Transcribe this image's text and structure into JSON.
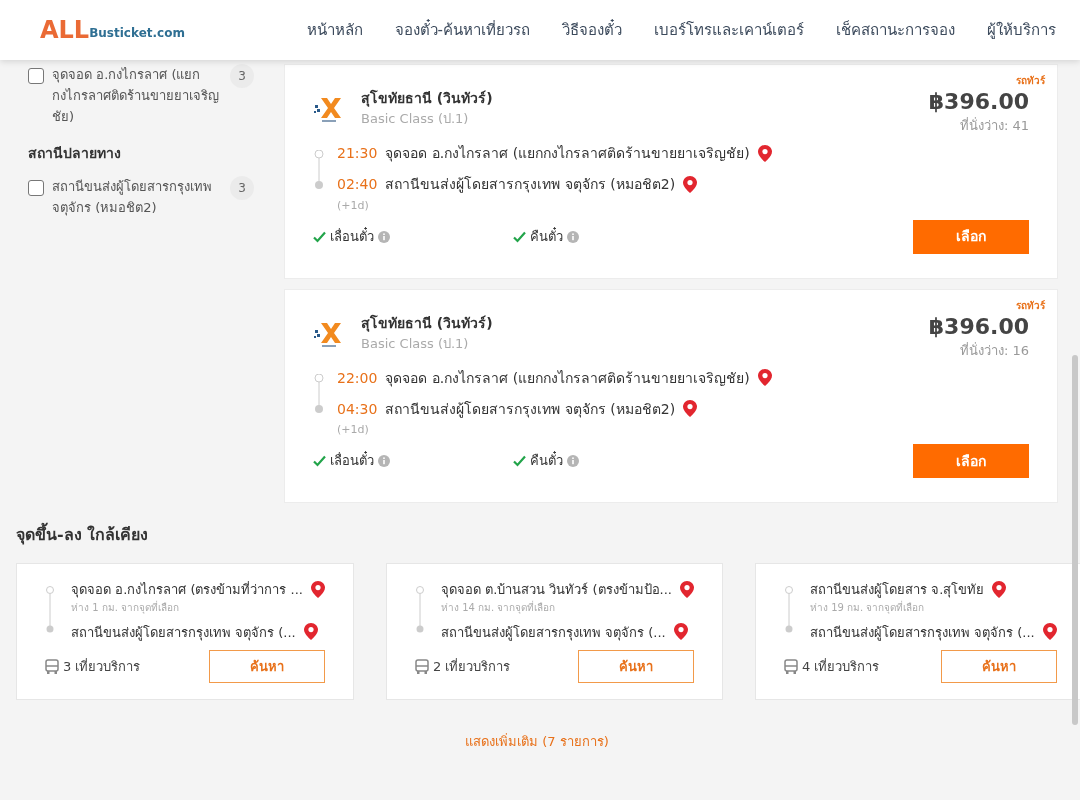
{
  "header": {
    "logo": {
      "big": "ALL",
      "small": "Busticket.com"
    },
    "nav": [
      {
        "label": "หน้าหลัก"
      },
      {
        "label": "จองตั๋ว-ค้นหาเที่ยวรถ"
      },
      {
        "label": "วิธีจองตั๋ว"
      },
      {
        "label": "เบอร์โทรและเคาน์เตอร์"
      },
      {
        "label": "เช็คสถานะการจอง"
      },
      {
        "label": "ผู้ให้บริการ"
      }
    ]
  },
  "sidebar": {
    "origin_items": [
      {
        "label": "จุดจอด อ.กงไกรลาศ (แยกกงไกรลาศติดร้านขายยาเจริญชัย)",
        "count": "3",
        "checked": false
      }
    ],
    "destination": {
      "title": "สถานีปลายทาง",
      "items": [
        {
          "label": "สถานีขนส่งผู้โดยสารกรุงเทพ จตุจักร (หมอชิต2)",
          "count": "3",
          "checked": false
        }
      ]
    }
  },
  "trips": [
    {
      "tag": "รถทัวร์",
      "operator": "สุโขทัยธานี (วินทัวร์)",
      "bus_class": "Basic Class (ป.1)",
      "price": "฿396.00",
      "seats": "ที่นั่งว่าง: 41",
      "departure": {
        "time": "21:30",
        "place": "จุดจอด อ.กงไกรลาศ (แยกกงไกรลาศติดร้านขายยาเจริญชัย)"
      },
      "arrival": {
        "time": "02:40",
        "place": "สถานีขนส่งผู้โดยสารกรุงเทพ จตุจักร (หมอชิต2)",
        "day_offset": "(+1d)"
      },
      "features": [
        {
          "label": "เลื่อนตั๋ว",
          "available": true
        },
        {
          "label": "คืนตั๋ว",
          "available": true
        }
      ],
      "button": "เลือก"
    },
    {
      "tag": "รถทัวร์",
      "operator": "สุโขทัยธานี (วินทัวร์)",
      "bus_class": "Basic Class (ป.1)",
      "price": "฿396.00",
      "seats": "ที่นั่งว่าง: 16",
      "departure": {
        "time": "22:00",
        "place": "จุดจอด อ.กงไกรลาศ (แยกกงไกรลาศติดร้านขายยาเจริญชัย)"
      },
      "arrival": {
        "time": "04:30",
        "place": "สถานีขนส่งผู้โดยสารกรุงเทพ จตุจักร (หมอชิต2)",
        "day_offset": "(+1d)"
      },
      "features": [
        {
          "label": "เลื่อนตั๋ว",
          "available": true
        },
        {
          "label": "คืนตั๋ว",
          "available": true
        }
      ],
      "button": "เลือก"
    }
  ],
  "nearby": {
    "title": "จุดขึ้น-ลง ใกล้เคียง",
    "cards": [
      {
        "from": "จุดจอด อ.กงไกรลาศ (ตรงข้ามที่ว่าการ ...",
        "distance": "ห่าง 1 กม. จากจุดที่เลือก",
        "to": "สถานีขนส่งผู้โดยสารกรุงเทพ จตุจักร (...",
        "trips": "3 เที่ยวบริการ",
        "button": "ค้นหา"
      },
      {
        "from": "จุดจอด ต.บ้านสวน วินทัวร์ (ตรงข้ามป้อ...",
        "distance": "ห่าง 14 กม. จากจุดที่เลือก",
        "to": "สถานีขนส่งผู้โดยสารกรุงเทพ จตุจักร (...",
        "trips": "2 เที่ยวบริการ",
        "button": "ค้นหา"
      },
      {
        "from": "สถานีขนส่งผู้โดยสาร จ.สุโขทัย",
        "distance": "ห่าง 19 กม. จากจุดที่เลือก",
        "to": "สถานีขนส่งผู้โดยสารกรุงเทพ จตุจักร (...",
        "trips": "4 เที่ยวบริการ",
        "button": "ค้นหา"
      }
    ]
  },
  "show_more": "แสดงเพิ่มเติม (7 รายการ)"
}
